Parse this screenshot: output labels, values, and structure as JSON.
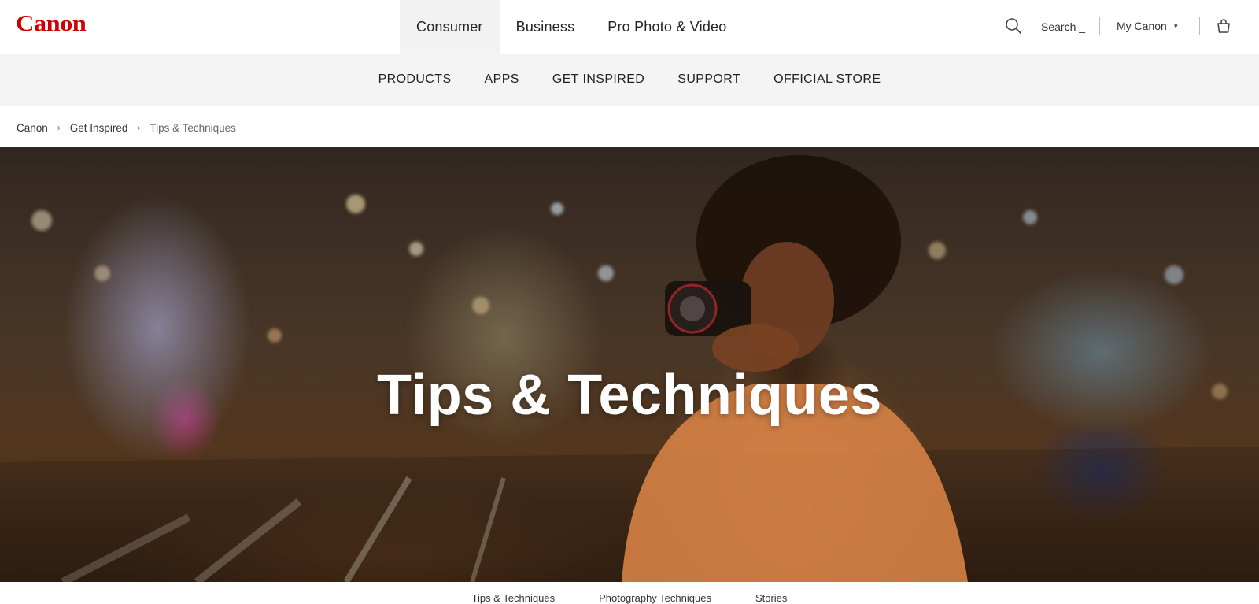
{
  "brand": {
    "name": "Canon",
    "color": "#cc0000"
  },
  "topbar": {
    "segments": [
      {
        "label": "Consumer",
        "active": true
      },
      {
        "label": "Business",
        "active": false
      },
      {
        "label": "Pro Photo & Video",
        "active": false
      }
    ],
    "search_label": "Search _",
    "account_label": "My Canon",
    "account_caret": "▾",
    "icons": [
      "search-icon",
      "chevron-down-icon",
      "shopping-bag-icon"
    ]
  },
  "main_nav": {
    "items": [
      "PRODUCTS",
      "APPS",
      "GET INSPIRED",
      "SUPPORT",
      "OFFICIAL STORE"
    ]
  },
  "breadcrumb": {
    "items": [
      "Canon",
      "Get Inspired",
      "Tips & Techniques"
    ],
    "separator": "›"
  },
  "hero": {
    "title": "Tips & Techniques"
  },
  "sub_tabs": {
    "items": [
      "Tips & Techniques",
      "Photography Techniques",
      "Stories"
    ]
  }
}
